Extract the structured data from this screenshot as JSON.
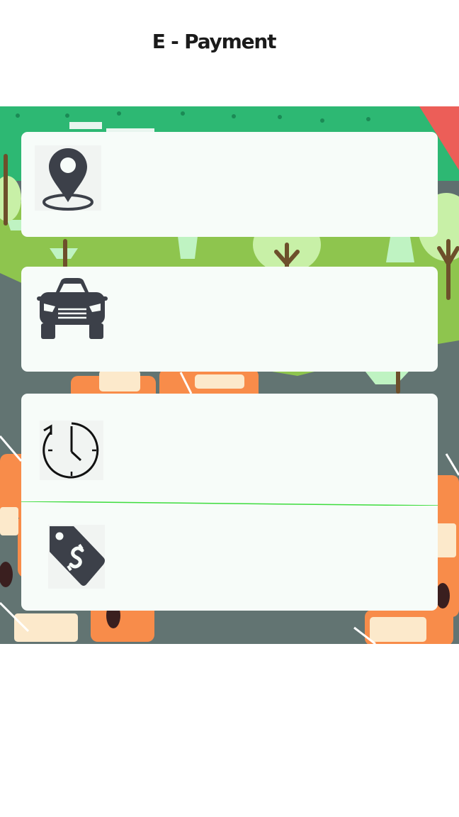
{
  "header": {
    "title": "E - Payment"
  },
  "menu": {
    "items": [
      {
        "id": "location",
        "icon": "location-pin-icon"
      },
      {
        "id": "vehicle",
        "icon": "car-icon"
      },
      {
        "id": "history",
        "icon": "clock-history-icon"
      },
      {
        "id": "price",
        "icon": "price-tag-icon"
      }
    ]
  },
  "colors": {
    "background": "#ffffff",
    "card": "#f7fcf9",
    "icon": "#3c4049",
    "divider": "#3ddc3d",
    "grass": "#8ec54e",
    "road": "#627472",
    "top_band": "#2db873",
    "cars": "#f88c4a"
  }
}
